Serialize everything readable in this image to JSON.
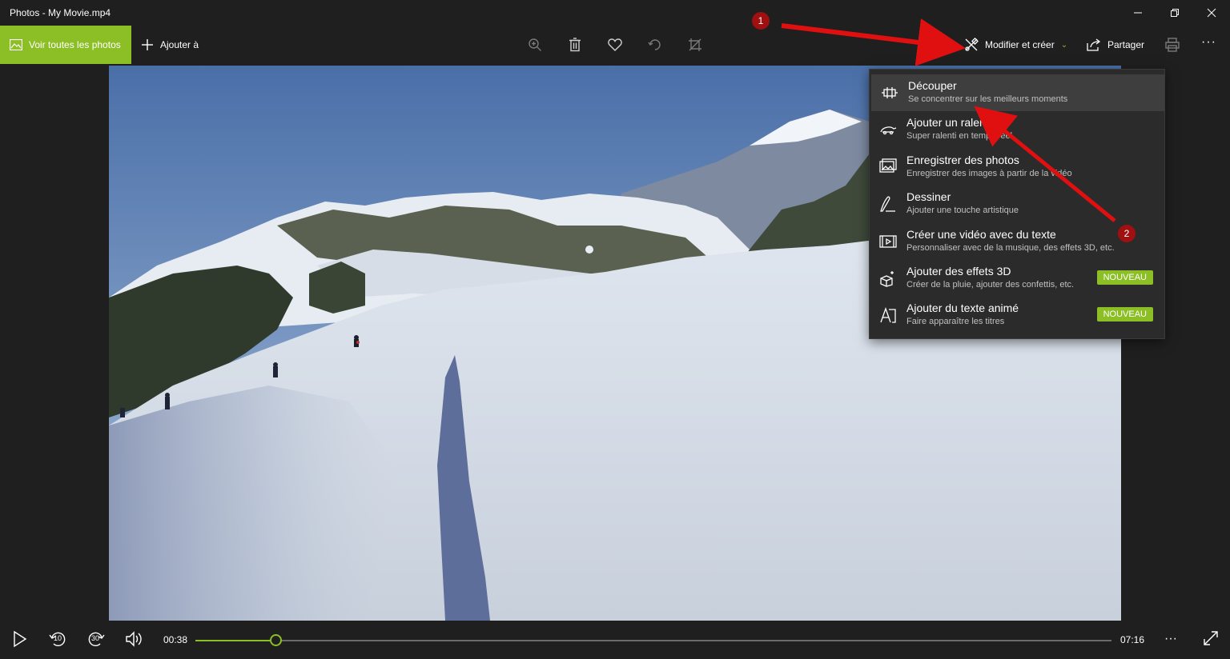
{
  "window": {
    "title": "Photos - My Movie.mp4"
  },
  "toolbar": {
    "see_all_label": "Voir toutes les photos",
    "add_to_label": "Ajouter à",
    "edit_create_label": "Modifier et créer",
    "share_label": "Partager",
    "accent_color": "#8cbf26"
  },
  "menu": {
    "items": [
      {
        "title": "Découper",
        "subtitle": "Se concentrer sur les meilleurs moments",
        "icon": "trim-icon",
        "badge": ""
      },
      {
        "title": "Ajouter un ralenti",
        "subtitle": "Super ralenti en temps réel",
        "icon": "slow-motion-icon",
        "badge": ""
      },
      {
        "title": "Enregistrer des photos",
        "subtitle": "Enregistrer des images à partir de la vidéo",
        "icon": "save-photos-icon",
        "badge": ""
      },
      {
        "title": "Dessiner",
        "subtitle": "Ajouter une touche artistique",
        "icon": "draw-icon",
        "badge": ""
      },
      {
        "title": "Créer une vidéo avec du texte",
        "subtitle": "Personnaliser avec de la musique, des effets 3D, etc.",
        "icon": "video-text-icon",
        "badge": ""
      },
      {
        "title": "Ajouter des effets 3D",
        "subtitle": "Créer de la pluie, ajouter des confettis, etc.",
        "icon": "effects-3d-icon",
        "badge": "NOUVEAU"
      },
      {
        "title": "Ajouter du texte animé",
        "subtitle": "Faire apparaître les titres",
        "icon": "animated-text-icon",
        "badge": "NOUVEAU"
      }
    ]
  },
  "player": {
    "current_time": "00:38",
    "total_time": "07:16",
    "progress_fraction": 0.087,
    "rewind_label": "10",
    "forward_label": "30"
  },
  "annotations": {
    "badge_1": "1",
    "badge_2": "2",
    "arrow_color": "#e01010"
  }
}
